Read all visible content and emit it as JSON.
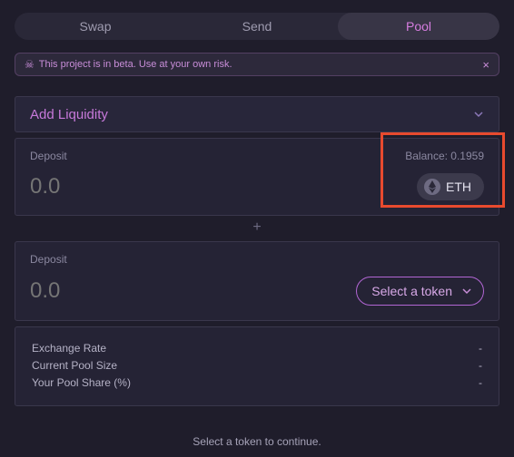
{
  "tabs": {
    "swap": "Swap",
    "send": "Send",
    "pool": "Pool"
  },
  "banner": {
    "text": "This project is in beta. Use at your own risk."
  },
  "section": {
    "title": "Add Liquidity"
  },
  "deposit1": {
    "label": "Deposit",
    "balance": "Balance: 0.1959",
    "placeholder": "0.0",
    "token": "ETH"
  },
  "plus": "+",
  "deposit2": {
    "label": "Deposit",
    "placeholder": "0.0",
    "select": "Select a token"
  },
  "info": {
    "rate_label": "Exchange Rate",
    "rate_val": "-",
    "size_label": "Current Pool Size",
    "size_val": "-",
    "share_label": "Your Pool Share (%)",
    "share_val": "-"
  },
  "hint": "Select a token to continue."
}
